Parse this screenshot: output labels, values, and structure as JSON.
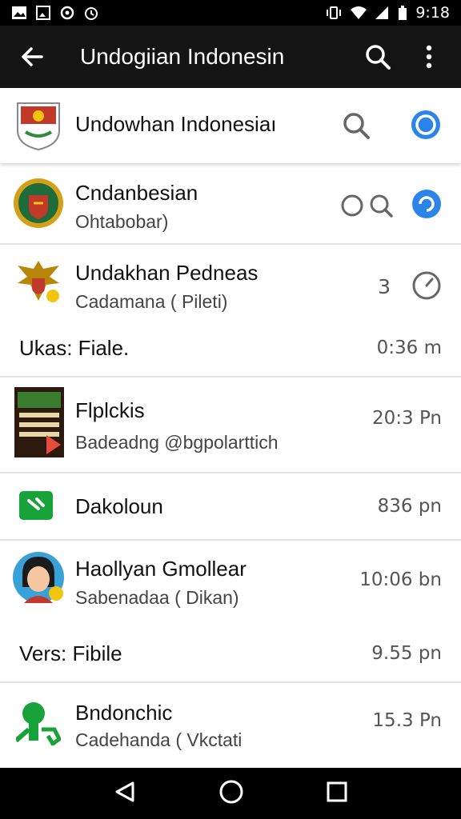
{
  "status_bar": {
    "time": "9:18",
    "left_icons": [
      "gallery-icon",
      "photo-icon",
      "sync-icon",
      "alarm-icon"
    ],
    "right_icons": [
      "vibrate-icon",
      "wifi-icon",
      "signal-icon",
      "battery-icon"
    ]
  },
  "app_bar": {
    "title": "Undogiian Indonesin",
    "back_icon": "arrow-left-icon",
    "search_icon": "search-icon",
    "menu_icon": "more-vert-icon"
  },
  "pinned": {
    "title": "Undowhan Indonesiaı",
    "icon": "emblem-shield-icon"
  },
  "items": [
    {
      "title": "Cndanbesian",
      "subtitle": "Ohtabobar)",
      "meta": ""
    },
    {
      "title": "Undakhan Pedneas",
      "subtitle": "Cadamana ( Pileti)",
      "meta": "3"
    },
    {
      "title": "Ukas: Fiale.",
      "meta": "0:36 m"
    },
    {
      "title": "Flplckis",
      "subtitle": "Badeadng @bgpolarttich",
      "meta": "20:3 Pn"
    },
    {
      "title": "Dakoloun",
      "meta": "836 pn"
    },
    {
      "title": "Haollyan Gmollear",
      "subtitle": "Sabenadaa ( Dikan)",
      "meta": "10:06 bn"
    },
    {
      "title": "Vers: Fibile",
      "meta": "9.55 pn"
    },
    {
      "title": "Bndonchic",
      "subtitle": "Cadehanda ( Vkctati",
      "meta": "15.3 Pn"
    }
  ],
  "colors": {
    "accent_blue": "#2b84e8",
    "appbar": "#141414",
    "green": "#1aa23a"
  }
}
